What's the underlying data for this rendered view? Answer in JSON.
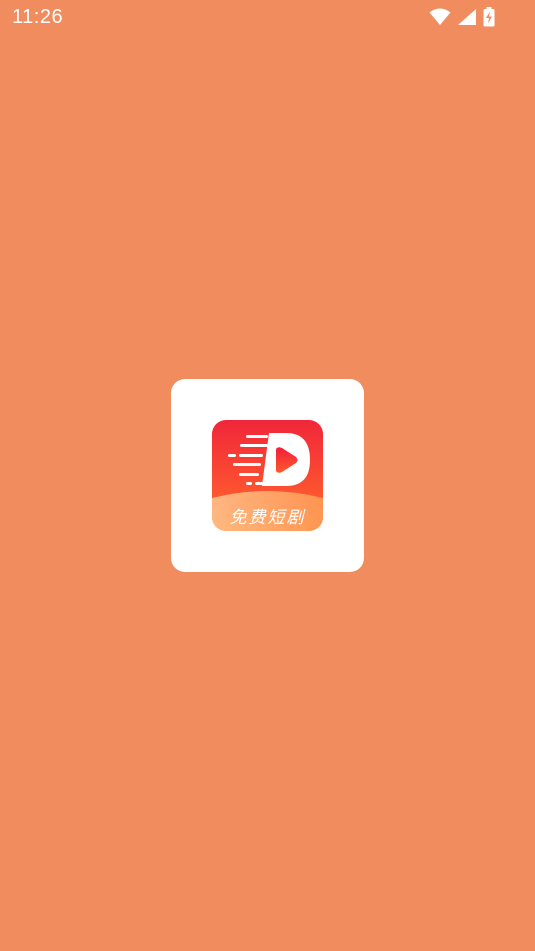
{
  "status_bar": {
    "time": "11:26",
    "icons": [
      "wifi-icon",
      "signal-icon",
      "battery-charging-icon"
    ]
  },
  "splash": {
    "background_color": "#F08C5E",
    "app_icon": {
      "icon": "play-d-logo-icon",
      "label": "免费短剧",
      "colors": {
        "top": "#F0263A",
        "bottom": "#FF7A2A",
        "band": "#FFB07A"
      }
    }
  }
}
